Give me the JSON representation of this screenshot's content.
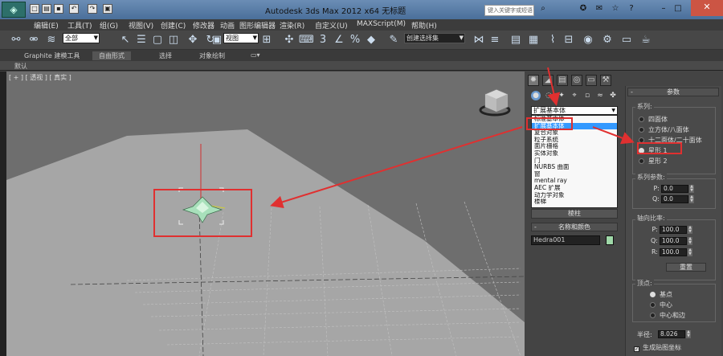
{
  "titlebar": {
    "title": "Autodesk 3ds Max  2012 x64      无标题",
    "search_placeholder": "键入关键字或短语"
  },
  "menu": [
    "编辑(E)",
    "工具(T)",
    "组(G)",
    "视图(V)",
    "创建(C)",
    "修改器",
    "动画",
    "图形编辑器",
    "渲染(R)",
    "自定义(U)",
    "MAXScript(M)",
    "帮助(H)"
  ],
  "toolbar": {
    "filter_value": "全部",
    "refcoord_value": "视图",
    "selection_set_placeholder": "创建选择集"
  },
  "ribbon": {
    "tabs": [
      "Graphite 建模工具",
      "自由形式",
      "选择",
      "对象绘制"
    ],
    "active_tab": "自由形式",
    "sub_label": "默认"
  },
  "viewport": {
    "label": "[ + ] [ 透视 ] [ 真实 ]"
  },
  "command_panel": {
    "category_value": "扩展基本体",
    "dropdown_items": [
      "标准基本体",
      "扩展基本体",
      "复合对象",
      "粒子系统",
      "面片栅格",
      "实体对象",
      "门",
      "NURBS 曲面",
      "窗",
      "mental ray",
      "AEC 扩展",
      "动力学对象",
      "楼梯"
    ],
    "selected_item": "扩展基本体",
    "visible_button": "棱柱",
    "name_color_title": "名称和颜色",
    "object_name": "Hedra001",
    "object_color": "#9fd8a8"
  },
  "params": {
    "title": "参数",
    "family_label": "系列:",
    "families": [
      {
        "label": "四面体",
        "selected": false
      },
      {
        "label": "立方体/八面体",
        "selected": false
      },
      {
        "label": "十二面体/二十面体",
        "selected": false
      },
      {
        "label": "星形 1",
        "selected": true
      },
      {
        "label": "星形 2",
        "selected": false
      }
    ],
    "family_params_label": "系列参数:",
    "P": "0.0",
    "Q": "0.0",
    "axis_ratio_label": "轴向比率:",
    "axis_P": "100.0",
    "axis_Q": "100.0",
    "axis_R": "100.0",
    "reset_label": "重置",
    "vertex_label": "顶点:",
    "vertex_options": [
      {
        "label": "基点",
        "selected": true
      },
      {
        "label": "中心",
        "selected": false
      },
      {
        "label": "中心和边",
        "selected": false
      }
    ],
    "radius_label": "半径:",
    "radius_value": "8.026",
    "gen_uv_label": "生成贴图坐标",
    "gen_uv_checked": true
  },
  "highlight_color": "#e03030"
}
